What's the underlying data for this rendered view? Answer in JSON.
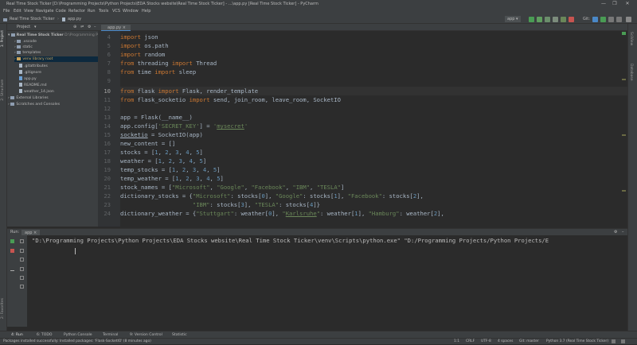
{
  "window": {
    "title": "Real Time Stock Ticker [D:\\Programming Projects\\Python Projects\\EDA Stocks website\\Real Time Stock Ticker] - ...\\app.py [Real Time Stock Ticker] - PyCharm",
    "min": "—",
    "max": "❐",
    "close": "✕"
  },
  "menu": [
    "File",
    "Edit",
    "View",
    "Navigate",
    "Code",
    "Refactor",
    "Run",
    "Tools",
    "VCS",
    "Window",
    "Help"
  ],
  "nav": {
    "project": "Real Time Stock Ticker",
    "file": "app.py",
    "run_config": "app",
    "git": "Git:"
  },
  "project_panel": {
    "title": "Project",
    "root": "Real Time Stock Ticker",
    "root_path": "D:\\Programming Projects\\Python Pr",
    "items": [
      ".vscode",
      "static",
      "templates",
      "venv  library root",
      ".gitattributes",
      ".gitignore",
      "app.py",
      "README.md",
      "weather_14.json"
    ],
    "external": "External Libraries",
    "scratches": "Scratches and Consoles"
  },
  "editor": {
    "tab": "app.py",
    "line_numbers": [
      "4",
      "5",
      "6",
      "7",
      "8",
      "9",
      "10",
      "11",
      "12",
      "13",
      "14",
      "15",
      "16",
      "17",
      "18",
      "19",
      "20",
      "21",
      "22",
      "23",
      "24"
    ]
  },
  "run": {
    "label": "Run:",
    "config": "app",
    "command": "\"D:\\Programming Projects\\Python Projects\\EDA Stocks website\\Real Time Stock Ticker\\venv\\Scripts\\python.exe\" \"D:/Programming Projects/Python Projects/E"
  },
  "bottom_tabs": [
    "4: Run",
    "6: TODO",
    "Python Console",
    "Terminal",
    "9: Version Control",
    "Statistic"
  ],
  "status": {
    "message": "Packages installed successfully: Installed packages: 'Flask-SocketIO' (8 minutes ago)",
    "pos": "1:1",
    "eol": "CRLF",
    "enc": "UTF-8",
    "indent": "4 spaces",
    "git": "Git: master",
    "interp": "Python 3.7 (Real Time Stock Ticker)"
  },
  "side_labels": {
    "left_top": "1: Project",
    "left_mid": "2: Structure",
    "left_bottom": "2: Favorites",
    "right_top": "SciView",
    "right_mid": "Database"
  }
}
